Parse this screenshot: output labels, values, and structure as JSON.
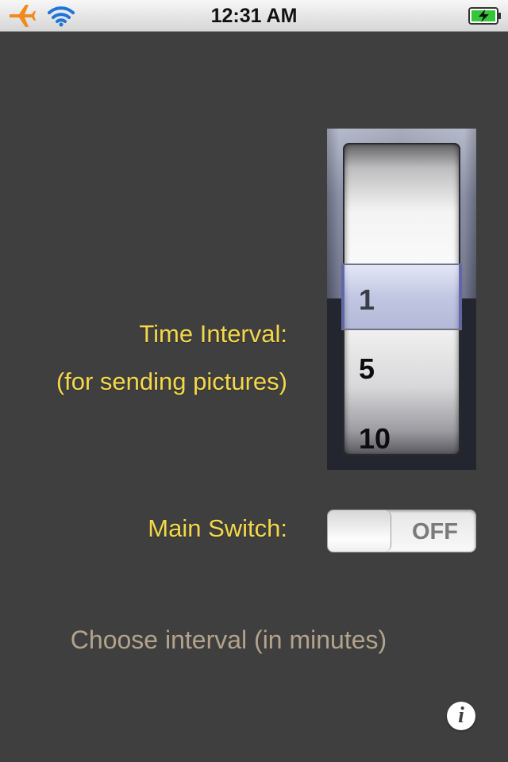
{
  "status_bar": {
    "time": "12:31 AM",
    "icons": [
      "airplane-icon",
      "wifi-icon",
      "battery-charging-icon"
    ],
    "accent_color": "#f08a1c"
  },
  "form": {
    "time_interval_label": "Time Interval:",
    "time_interval_sublabel": "(for sending pictures)",
    "main_switch_label": "Main Switch:"
  },
  "picker": {
    "options": [
      "1",
      "5",
      "10"
    ],
    "selected": "1"
  },
  "main_switch": {
    "state_label": "OFF"
  },
  "footer": {
    "hint": "Choose interval (in minutes)",
    "info_glyph": "i"
  },
  "colors": {
    "background": "#3f3f3f",
    "label_yellow": "#f5d84a",
    "hint_tan": "#b3a38c"
  }
}
